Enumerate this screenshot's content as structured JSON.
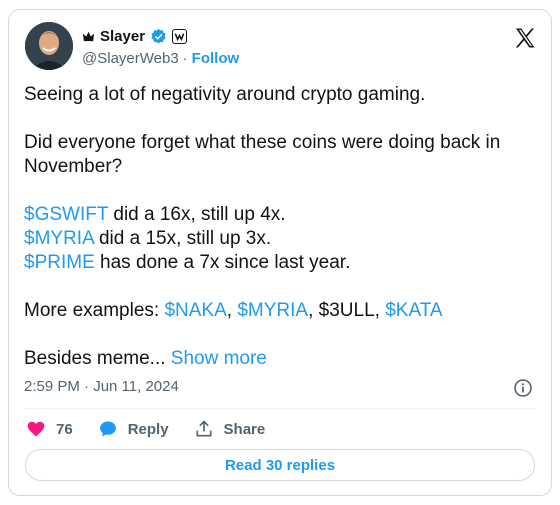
{
  "author": {
    "name": "Slayer",
    "handle": "@SlayerWeb3",
    "separator": "·",
    "follow_label": "Follow"
  },
  "tweet": {
    "line1": "Seeing a lot of negativity around crypto gaming.",
    "line2": "Did everyone forget what these coins were doing back in November?",
    "items": [
      {
        "tag": "$GSWIFT",
        "text": " did a 16x, still up 4x."
      },
      {
        "tag": "$MYRIA",
        "text": " did a 15x, still up 3x."
      },
      {
        "tag": "$PRIME",
        "text": " has done a 7x since last year."
      }
    ],
    "examples": {
      "prefix": "More examples: ",
      "tag1": "$NAKA",
      "sep1": ", ",
      "tag2": "$MYRIA",
      "sep2": ", ",
      "plain": "$3ULL",
      "sep3": ", ",
      "tag3": "$KATA"
    },
    "truncated": "Besides meme...",
    "show_more": "Show more",
    "timestamp": "2:59 PM · Jun 11, 2024"
  },
  "actions": {
    "like_count": "76",
    "reply_label": "Reply",
    "share_label": "Share"
  },
  "replies_button": "Read 30 replies",
  "colors": {
    "accent": "#1d9bf0",
    "like": "#f91880",
    "text": "#0f1419",
    "secondary": "#536471"
  },
  "icons": [
    "crown-icon",
    "verified-icon",
    "affiliate-icon",
    "x-logo-icon",
    "info-icon",
    "heart-icon",
    "reply-icon",
    "share-icon"
  ]
}
